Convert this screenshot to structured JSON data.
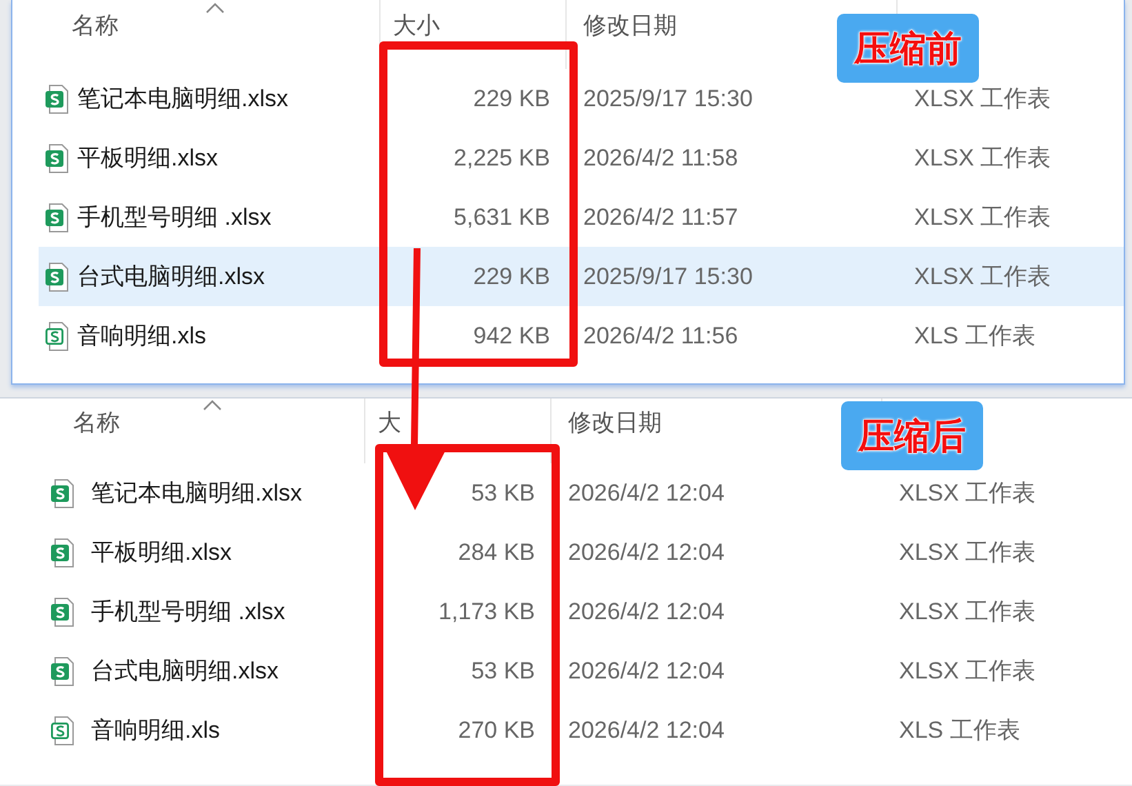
{
  "panels": [
    {
      "badge": "压缩前",
      "columns": [
        {
          "label": "名称"
        },
        {
          "label": "大小"
        },
        {
          "label": "修改日期"
        }
      ],
      "rows": [
        {
          "kind": "xlsx",
          "name": "笔记本电脑明细.xlsx",
          "size": "229 KB",
          "modified": "2025/9/17 15:30",
          "type": "XLSX 工作表",
          "selected": false
        },
        {
          "kind": "xlsx",
          "name": "平板明细.xlsx",
          "size": "2,225 KB",
          "modified": "2026/4/2 11:58",
          "type": "XLSX 工作表",
          "selected": false
        },
        {
          "kind": "xlsx",
          "name": "手机型号明细 .xlsx",
          "size": "5,631 KB",
          "modified": "2026/4/2 11:57",
          "type": "XLSX 工作表",
          "selected": false
        },
        {
          "kind": "xlsx",
          "name": "台式电脑明细.xlsx",
          "size": "229 KB",
          "modified": "2025/9/17 15:30",
          "type": "XLSX 工作表",
          "selected": true
        },
        {
          "kind": "xls",
          "name": "音响明细.xls",
          "size": "942 KB",
          "modified": "2026/4/2 11:56",
          "type": "XLS 工作表",
          "selected": false
        }
      ]
    },
    {
      "badge": "压缩后",
      "columns": [
        {
          "label": "名称"
        },
        {
          "label": "大"
        },
        {
          "label": "修改日期"
        }
      ],
      "rows": [
        {
          "kind": "xlsx",
          "name": "笔记本电脑明细.xlsx",
          "size": "53 KB",
          "modified": "2026/4/2 12:04",
          "type": "XLSX 工作表",
          "selected": false
        },
        {
          "kind": "xlsx",
          "name": "平板明细.xlsx",
          "size": "284 KB",
          "modified": "2026/4/2 12:04",
          "type": "XLSX 工作表",
          "selected": false
        },
        {
          "kind": "xlsx",
          "name": "手机型号明细 .xlsx",
          "size": "1,173 KB",
          "modified": "2026/4/2 12:04",
          "type": "XLSX 工作表",
          "selected": false
        },
        {
          "kind": "xlsx",
          "name": "台式电脑明细.xlsx",
          "size": "53 KB",
          "modified": "2026/4/2 12:04",
          "type": "XLSX 工作表",
          "selected": false
        },
        {
          "kind": "xls",
          "name": "音响明细.xls",
          "size": "270 KB",
          "modified": "2026/4/2 12:04",
          "type": "XLS 工作表",
          "selected": false
        }
      ]
    }
  ]
}
